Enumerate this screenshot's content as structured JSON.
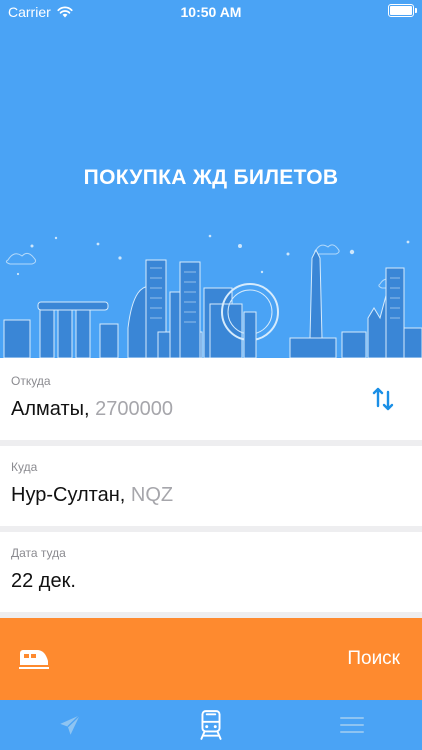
{
  "status_bar": {
    "carrier": "Carrier",
    "time": "10:50 AM",
    "battery_level": 1.0
  },
  "header": {
    "title": "ПОКУПКА ЖД БИЛЕТОВ"
  },
  "form": {
    "from": {
      "label": "Откуда",
      "city": "Алматы,",
      "code": "2700000"
    },
    "to": {
      "label": "Куда",
      "city": "Нур-Султан,",
      "code": "NQZ"
    },
    "date": {
      "label": "Дата туда",
      "value": "22 дек."
    }
  },
  "search_button": {
    "label": "Поиск"
  },
  "tabbar": {
    "tabs": [
      "plane-icon",
      "train-icon",
      "menu-icon"
    ],
    "active": "train-icon"
  },
  "colors": {
    "header_bg": "#4aa3f5",
    "accent": "#fe8a2f",
    "swap_icon": "#1a8fe6",
    "skyline": "#2f7fd0"
  }
}
